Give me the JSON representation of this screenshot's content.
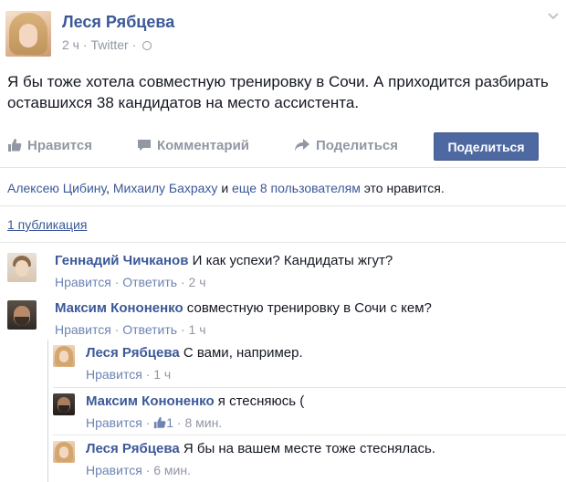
{
  "post": {
    "author": "Леся Рябцева",
    "time": "2 ч",
    "source": "Twitter",
    "separator": "·",
    "text": "Я бы тоже хотела совместную тренировку в Сочи. А приходится разбирать оставшихся 38 кандидатов на место ассистента."
  },
  "actions": {
    "like": "Нравится",
    "comment": "Комментарий",
    "share": "Поделиться",
    "share_button": "Поделиться"
  },
  "likes": {
    "name1": "Алексею Цибину",
    "comma": ", ",
    "name2": "Михаилу Бахраху",
    "and": " и ",
    "others": "еще 8 пользователям",
    "suffix": " это нравится."
  },
  "publications": "1 публикация",
  "comments": [
    {
      "author": "Геннадий Чичканов",
      "text": " И как успехи? Кандидаты жгут?",
      "like": "Нравится",
      "sep": " · ",
      "reply": "Ответить",
      "time": "2 ч"
    },
    {
      "author": "Максим Кононенко",
      "text": " совместную тренировку в Сочи с кем?",
      "like": "Нравится",
      "sep": " · ",
      "reply": "Ответить",
      "time": "1 ч"
    }
  ],
  "replies": [
    {
      "author": "Леся Рябцева",
      "text": " С вами, например.",
      "like": "Нравится",
      "sep": " · ",
      "time": "1 ч"
    },
    {
      "author": "Максим Кононенко",
      "text": " я стесняюсь (",
      "like": "Нравится",
      "sep": " · ",
      "likes": "1",
      "time": "8 мин."
    },
    {
      "author": "Леся Рябцева",
      "text": " Я бы на вашем месте тоже стеснялась.",
      "like": "Нравится",
      "sep": " · ",
      "time": "6 мин."
    }
  ],
  "colors": {
    "link": "#3b5998",
    "muted": "#9197a3",
    "button": "#4e69a2"
  }
}
